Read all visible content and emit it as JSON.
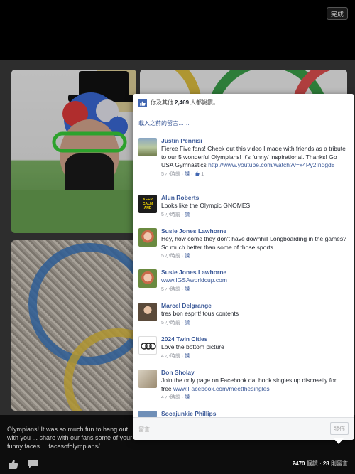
{
  "topbar": {
    "done_label": "完成"
  },
  "popover": {
    "likes_prefix": "你及其他",
    "likes_count": "2,469",
    "likes_suffix": "人都說讚。",
    "load_previous": "載入之前的留言……",
    "comments": [
      {
        "name": "Justin Pennisi",
        "text": "Fierce Five fans! Check out this video I made with friends as a tribute to our 5 wonderful Olympians! It's funny/ inspirational. Thanks! Go USA Gymnastics ",
        "link": "http://www.youtube.com/watch?v=x4Py2Indgd8",
        "time": "5 小時前",
        "like_label": "讚",
        "like_count": "1",
        "avatar": "landscape-photo"
      },
      {
        "name": "Alun Roberts",
        "text": "Looks like the Olympic GNOMES",
        "time": "5 小時前",
        "like_label": "讚",
        "avatar_text": "KEEP CALM AND",
        "avatar": "keep-calm-poster"
      },
      {
        "name": "Susie Jones Lawhorne",
        "text": "Hey, how come they don't have downhill Longboarding in the games?  So much better than some of those sports",
        "time": "5 小時前",
        "like_label": "讚",
        "avatar": "woman-red-hair"
      },
      {
        "name": "Susie Jones Lawhorne",
        "link": "www.IGSAworldcup.com",
        "time": "5 小時前",
        "like_label": "讚",
        "avatar": "woman-red-hair"
      },
      {
        "name": "Marcel Delgrange",
        "text": "tres bon esprit!  tous contents",
        "time": "5 小時前",
        "like_label": "讚",
        "avatar": "man-portrait"
      },
      {
        "name": "2024 Twin Cities",
        "text": "Love the bottom picture",
        "time": "4 小時前",
        "like_label": "讚",
        "avatar": "olympic-rings-logo"
      },
      {
        "name": "Don Sholay",
        "text": "Join the only page on Facebook dat hook singles up discreetly for free ",
        "link": "www.Facebook.com/meetthesingles",
        "time": "4 小時前",
        "like_label": "讚",
        "avatar": "couple-photo"
      },
      {
        "name": "Socajunkie Phillips",
        "avatar": "blue-photo"
      }
    ],
    "input_placeholder": "留言……",
    "post_label": "發佈"
  },
  "caption": {
    "text": "Olympians! It was so much fun to hang out with you ... share with our fans some of your funny faces ... facesofolympians/"
  },
  "bottom_bar": {
    "likes_count": "2470",
    "likes_label": "個讚",
    "separator": "·",
    "comments_count": "28",
    "comments_label": "則留言"
  },
  "colors": {
    "link": "#3b5998",
    "meta": "#90949c",
    "backdrop": "#000000"
  }
}
